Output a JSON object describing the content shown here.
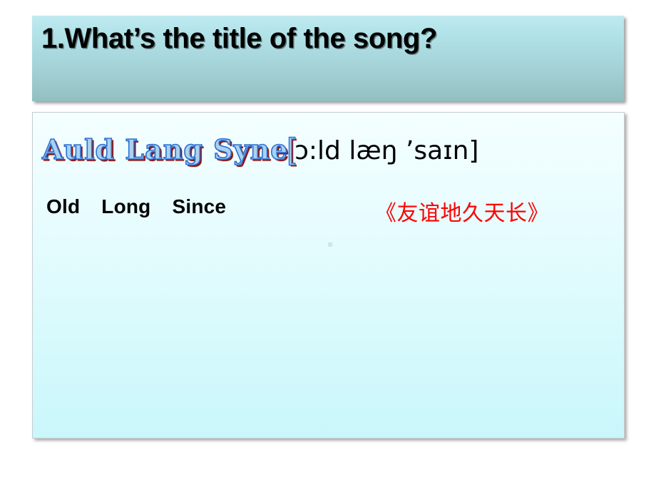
{
  "slide": {
    "title": "1.What’s the title of the song?",
    "title_bar_gradient_top": "#bfeaf0",
    "title_bar_gradient_bottom": "#93bfc0",
    "content_gradient_top": "#f4ffff",
    "content_gradient_bottom": "#c9f7fb"
  },
  "content": {
    "song_title": "Auld Lang Syne",
    "phonetic_open_bracket": "[",
    "phonetic": "ɔ:ld læŋ ’saɪn]",
    "gloss_words": [
      {
        "label": "Old"
      },
      {
        "label": "Long"
      },
      {
        "label": "Since"
      }
    ],
    "chinese_title": "《友谊地久天长》",
    "chinese_title_color": "#ff0000",
    "song_title_fill_color": "#a8d3f0",
    "song_title_outline_color": "#2e6fd0",
    "song_title_shadow_color": "#8d1414"
  }
}
